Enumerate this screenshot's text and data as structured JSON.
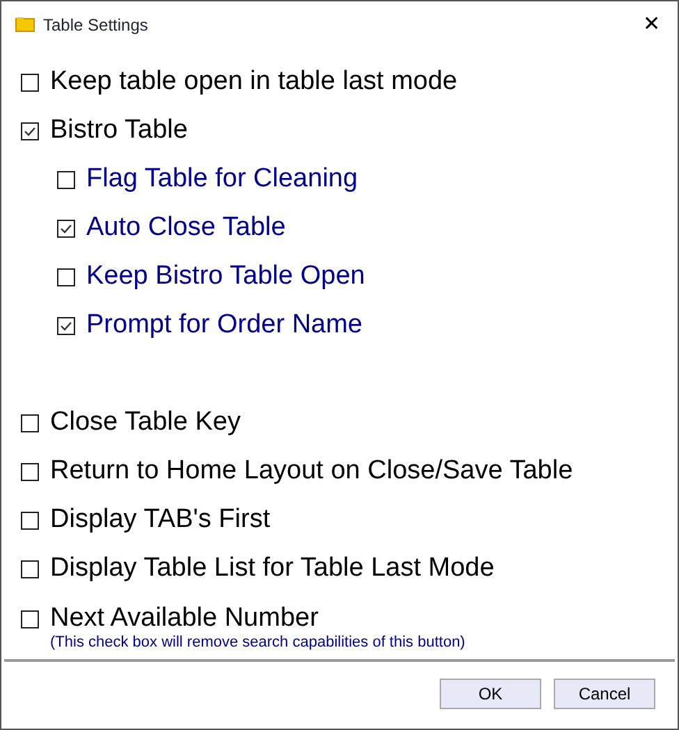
{
  "window": {
    "title": "Table Settings",
    "close": "✕"
  },
  "options": [
    {
      "label": "Keep table open in table last mode",
      "checked": false
    },
    {
      "label": "Bistro Table",
      "checked": true,
      "children": [
        {
          "label": "Flag Table for Cleaning",
          "checked": false
        },
        {
          "label": "Auto Close Table",
          "checked": true
        },
        {
          "label": "Keep Bistro Table Open",
          "checked": false
        },
        {
          "label": "Prompt for Order Name",
          "checked": true
        }
      ]
    },
    {
      "label": "Close Table Key",
      "checked": false
    },
    {
      "label": "Return to Home Layout on Close/Save Table",
      "checked": false
    },
    {
      "label": "Display TAB's First",
      "checked": false
    },
    {
      "label": "Display Table List for Table Last Mode",
      "checked": false
    },
    {
      "label": "Next Available Number",
      "checked": false,
      "note": "(This check box will remove search capabilities of this button)"
    }
  ],
  "buttons": [
    "OK",
    "Cancel"
  ]
}
